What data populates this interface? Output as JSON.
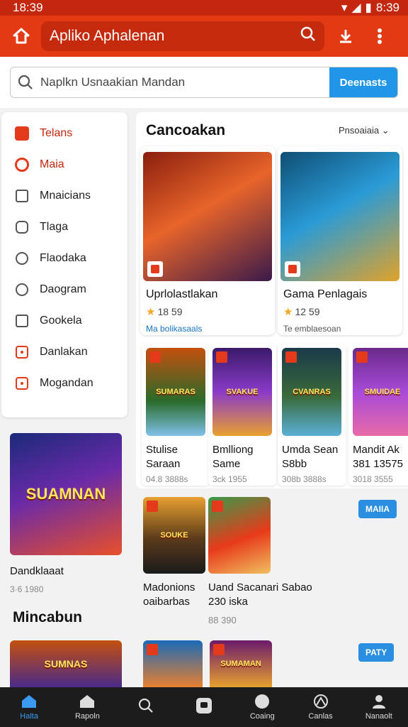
{
  "status": {
    "time": "18:39",
    "right": "8:39"
  },
  "app": {
    "title": "Apliko Aphalenan"
  },
  "search": {
    "placeholder": "Naplkn Usnaakian Mandan",
    "button": "Deenasts"
  },
  "sidebar": {
    "items": [
      {
        "label": "Telans",
        "icon": "tag-icon",
        "active": true
      },
      {
        "label": "Maia",
        "icon": "target-icon",
        "active": true
      },
      {
        "label": "Mnaicians",
        "icon": "square-icon",
        "active": false
      },
      {
        "label": "Tlaga",
        "icon": "folder-icon",
        "active": false
      },
      {
        "label": "Flaodaka",
        "icon": "leaf-icon",
        "active": false
      },
      {
        "label": "Daogram",
        "icon": "circle-icon",
        "active": false
      },
      {
        "label": "Gookela",
        "icon": "square-icon",
        "active": false
      },
      {
        "label": "Danlakan",
        "icon": "box-icon",
        "active": false
      },
      {
        "label": "Mogandan",
        "icon": "record-icon",
        "active": false
      }
    ]
  },
  "left_feature": {
    "art_text": "SUAMNAN",
    "title": "Dandklaaat",
    "meta": "3·6 1980"
  },
  "section": {
    "title": "Cancoakan",
    "sort": "Pnsoaiaia"
  },
  "big_cards": [
    {
      "title": "Uprlolastlakan",
      "rating": "18 59",
      "sub": "Ma bolikasaals",
      "colors": [
        "#8a1f0e",
        "#e8642a",
        "#3a1a4a"
      ]
    },
    {
      "title": "Gama Penlagais",
      "rating": "12 59",
      "sub": "Te emblaesoan",
      "colors": [
        "#0f4e74",
        "#2a9bd6",
        "#e0a22a"
      ]
    }
  ],
  "small_cards": [
    {
      "art": "SUMARAS",
      "line1": "Stulise",
      "line2": "Saraan",
      "meta": "04.8 3888s",
      "colors": [
        "#2a6a2a",
        "#7fc1e8"
      ]
    },
    {
      "art": "SVAKUE",
      "line1": "Bmlliong",
      "line2": "Same",
      "meta": "3ck 1955",
      "colors": [
        "#3a1a6a",
        "#e8a030"
      ]
    },
    {
      "art": "CVANRAS",
      "line1": "Umda Sean",
      "line2": "S8bb",
      "meta": "308b 3888s",
      "colors": [
        "#1a3a4a",
        "#5ab0d8"
      ]
    },
    {
      "art": "SMUIDAE",
      "line1": "Mandit Ak",
      "line2": "381 13575",
      "meta": "3018 3555",
      "colors": [
        "#6a2a8a",
        "#e86aa8"
      ]
    }
  ],
  "third_row": {
    "cards": [
      {
        "art": "SOUKE",
        "line1": "Madonions",
        "line2": "oaibarbas",
        "colors": [
          "#1a1a1a",
          "#e8a030"
        ]
      },
      {
        "art": "",
        "line1": "Uand Sacanari Sabao",
        "line2": "230 iska",
        "meta": "88 390",
        "colors": [
          "#e83a1a",
          "#3a9a4a"
        ]
      }
    ],
    "pill": "MAIIA"
  },
  "section2": {
    "title": "Mincabun",
    "pill": "PATY"
  },
  "bottom_row": [
    {
      "art": "SUMNAS",
      "colors": [
        "#c4500e",
        "#4a2a8a"
      ]
    },
    {
      "art": "",
      "colors": [
        "#1a6ab8",
        "#e88030"
      ]
    },
    {
      "art": "SUMAMAN",
      "colors": [
        "#6a1a6a",
        "#e8a030"
      ]
    }
  ],
  "bottom_nav": [
    {
      "label": "Halta",
      "icon": "home-icon",
      "active": true
    },
    {
      "label": "Rapoln",
      "icon": "house-icon",
      "active": false
    },
    {
      "label": "",
      "icon": "search-icon",
      "active": false
    },
    {
      "label": "",
      "icon": "library-icon",
      "active": false
    },
    {
      "label": "Coaing",
      "icon": "heart-icon",
      "active": false
    },
    {
      "label": "Canlas",
      "icon": "puzzle-icon",
      "active": false
    },
    {
      "label": "Nanaolt",
      "icon": "profile-icon",
      "active": false
    }
  ]
}
